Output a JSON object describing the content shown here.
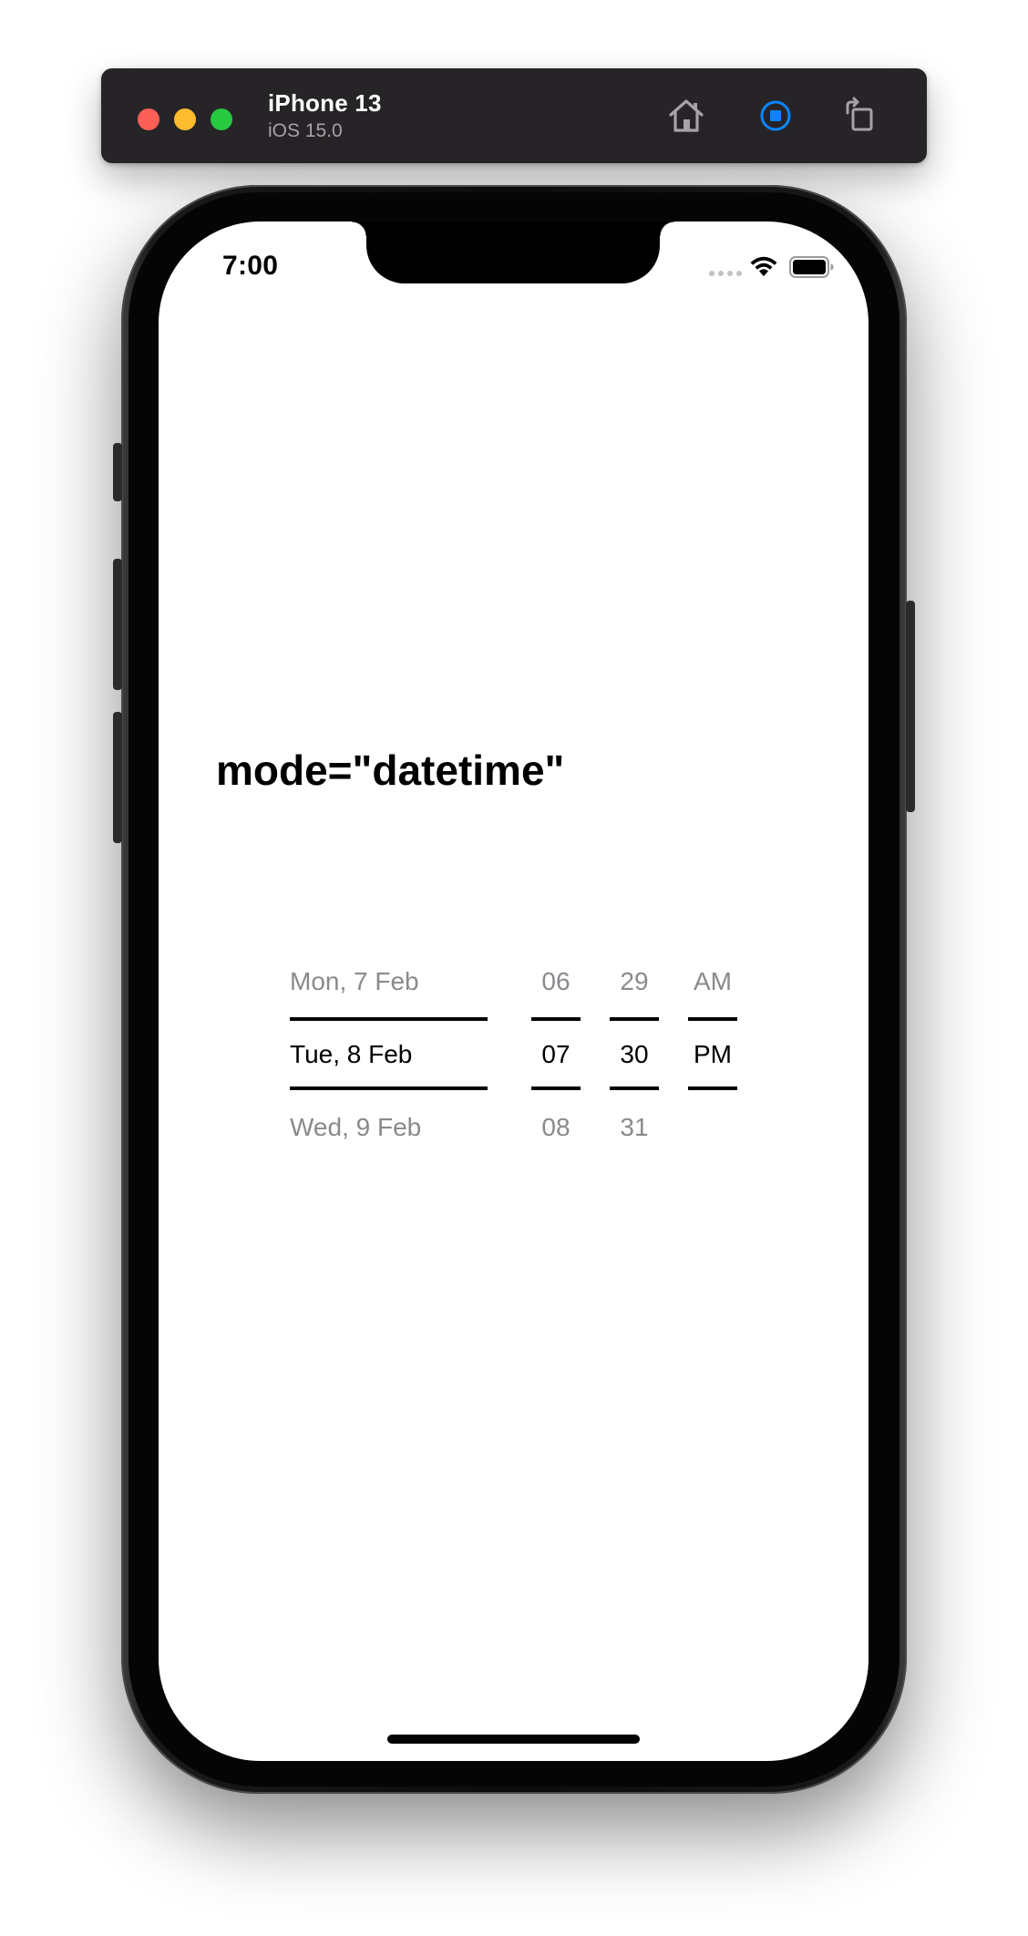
{
  "simulator": {
    "device_name": "iPhone 13",
    "os_version": "iOS 15.0",
    "buttons": {
      "home_icon": "home-icon",
      "stop_icon": "stop-icon",
      "rotate_icon": "rotate-icon"
    },
    "colors": {
      "bar": "#272427",
      "close": "#fe5f57",
      "minimize": "#febc2e",
      "zoom": "#28c840",
      "accent": "#0a84ff"
    }
  },
  "status_bar": {
    "time": "7:00"
  },
  "screen": {
    "title": "mode=\"datetime\""
  },
  "datetime_picker": {
    "date_column": {
      "above": "Mon, 7 Feb",
      "selected": "Tue, 8 Feb",
      "below": "Wed, 9 Feb"
    },
    "hour_column": {
      "above": "06",
      "selected": "07",
      "below": "08"
    },
    "minute_column": {
      "above": "29",
      "selected": "30",
      "below": "31"
    },
    "period_column": {
      "above": "AM",
      "selected": "PM"
    }
  }
}
